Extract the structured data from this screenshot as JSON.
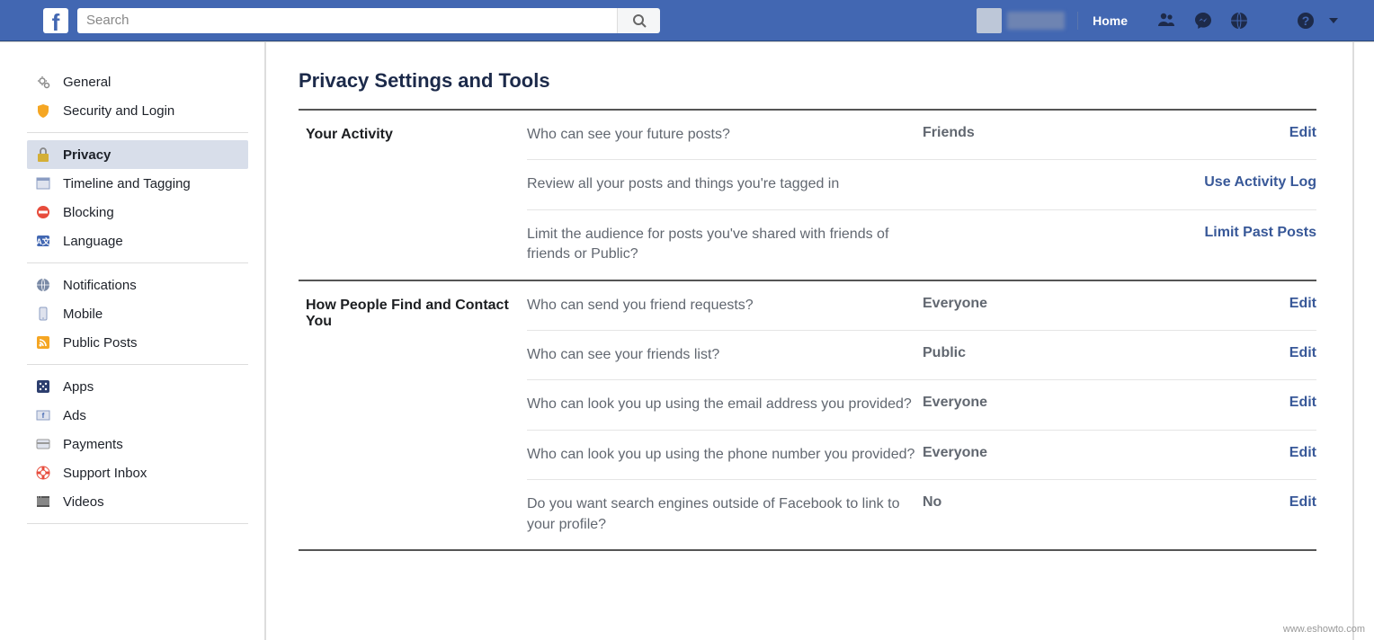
{
  "topbar": {
    "search_placeholder": "Search",
    "home": "Home"
  },
  "sidebar": {
    "groups": [
      [
        {
          "icon": "gears",
          "label": "General"
        },
        {
          "icon": "shield",
          "label": "Security and Login"
        }
      ],
      [
        {
          "icon": "lock",
          "label": "Privacy",
          "active": true
        },
        {
          "icon": "window",
          "label": "Timeline and Tagging"
        },
        {
          "icon": "blocked",
          "label": "Blocking"
        },
        {
          "icon": "language",
          "label": "Language"
        }
      ],
      [
        {
          "icon": "globe",
          "label": "Notifications"
        },
        {
          "icon": "mobile",
          "label": "Mobile"
        },
        {
          "icon": "rss",
          "label": "Public Posts"
        }
      ],
      [
        {
          "icon": "apps",
          "label": "Apps"
        },
        {
          "icon": "ads",
          "label": "Ads"
        },
        {
          "icon": "card",
          "label": "Payments"
        },
        {
          "icon": "lifebuoy",
          "label": "Support Inbox"
        },
        {
          "icon": "film",
          "label": "Videos"
        }
      ]
    ]
  },
  "page": {
    "title": "Privacy Settings and Tools",
    "sections": [
      {
        "label": "Your Activity",
        "rows": [
          {
            "label": "Who can see your future posts?",
            "value": "Friends",
            "action": "Edit"
          },
          {
            "label": "Review all your posts and things you're tagged in",
            "value": "",
            "action": "Use Activity Log"
          },
          {
            "label": "Limit the audience for posts you've shared with friends of friends or Public?",
            "value": "",
            "action": "Limit Past Posts"
          }
        ]
      },
      {
        "label": "How People Find and Contact You",
        "rows": [
          {
            "label": "Who can send you friend requests?",
            "value": "Everyone",
            "action": "Edit"
          },
          {
            "label": "Who can see your friends list?",
            "value": "Public",
            "action": "Edit"
          },
          {
            "label": "Who can look you up using the email address you provided?",
            "value": "Everyone",
            "action": "Edit"
          },
          {
            "label": "Who can look you up using the phone number you provided?",
            "value": "Everyone",
            "action": "Edit"
          },
          {
            "label": "Do you want search engines outside of Facebook to link to your profile?",
            "value": "No",
            "action": "Edit"
          }
        ]
      }
    ]
  },
  "watermark": "www.eshowto.com"
}
